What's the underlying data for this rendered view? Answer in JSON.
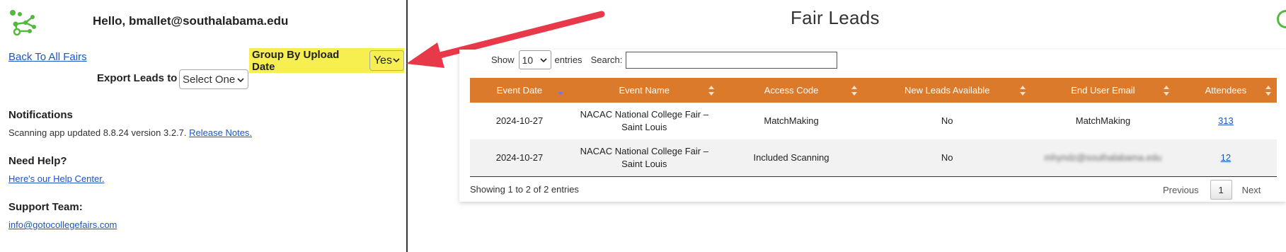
{
  "sidebar": {
    "greeting": "Hello, bmallet@southalabama.edu",
    "back_link": "Back To All Fairs",
    "group_by_label": "Group By Upload Date",
    "group_by_value": "Yes",
    "export_label": "Export Leads to",
    "export_value": "Select One",
    "notifications": {
      "heading": "Notifications",
      "text": "Scanning app updated 8.8.24 version 3.2.7.",
      "link": "Release Notes."
    },
    "help": {
      "heading": "Need Help?",
      "link": "Here's our Help Center."
    },
    "support": {
      "heading": "Support Team:",
      "link": "info@gotocollegefairs.com"
    }
  },
  "main": {
    "title": "Fair Leads",
    "show_label": "Show",
    "page_length": "10",
    "entries_label": "entries",
    "search_label": "Search:",
    "search_value": "",
    "columns": [
      "Event Date",
      "Event Name",
      "Access Code",
      "New Leads Available",
      "End User Email",
      "Attendees"
    ],
    "rows": [
      {
        "event_date": "2024-10-27",
        "event_name_1": "NACAC National College Fair –",
        "event_name_2": "Saint Louis",
        "access_code": "MatchMaking",
        "new_leads": "No",
        "email": "MatchMaking",
        "attendees": "313"
      },
      {
        "event_date": "2024-10-27",
        "event_name_1": "NACAC National College Fair –",
        "event_name_2": "Saint Louis",
        "access_code": "Included Scanning",
        "new_leads": "No",
        "email": "mhyndz@southalabama.edu",
        "attendees": "12"
      }
    ],
    "info": "Showing 1 to 2 of 2 entries",
    "pagination": {
      "previous": "Previous",
      "current": "1",
      "next": "Next"
    }
  },
  "colors": {
    "header_orange": "#dc7a2c",
    "highlight_yellow": "#f6ef4f",
    "arrow_red": "#e8394a",
    "logo_green": "#55b83e",
    "link_blue": "#1a56c4"
  }
}
